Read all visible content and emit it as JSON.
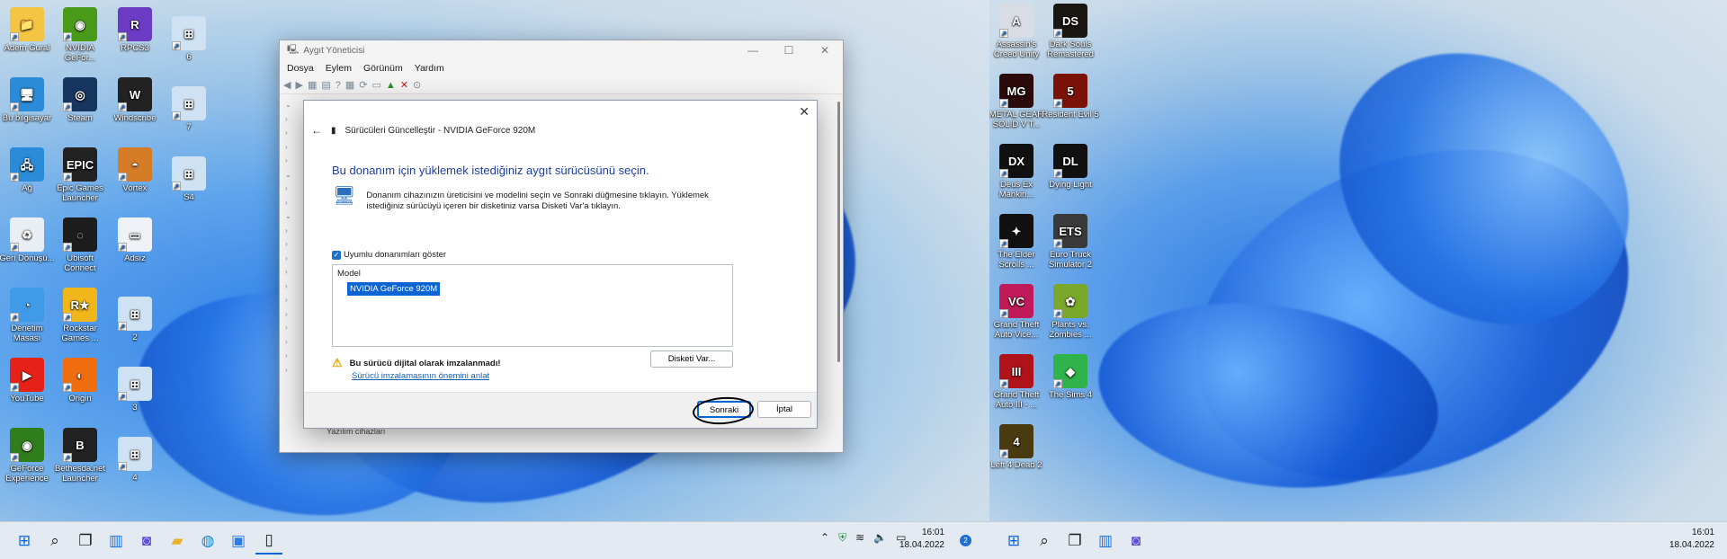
{
  "desktop_left": {
    "icons": [
      {
        "label": "Adem Gural",
        "icon": "folder-icon",
        "color": "#f4c542",
        "glyph": "📁"
      },
      {
        "label": "Bu bilgisayar",
        "icon": "monitor-icon",
        "color": "#2a8cd8",
        "glyph": "🖥"
      },
      {
        "label": "Ağ",
        "icon": "network-icon",
        "color": "#2a8cd8",
        "glyph": "🖧"
      },
      {
        "label": "Geri Dönüşü...",
        "icon": "recycle-bin-icon",
        "color": "#e8eef4",
        "glyph": "♻"
      },
      {
        "label": "Denetim Masası",
        "icon": "control-panel-icon",
        "color": "#3f9be8",
        "glyph": "◔"
      },
      {
        "label": "YouTube",
        "icon": "youtube-icon",
        "color": "#e62117",
        "glyph": "▶"
      },
      {
        "label": "GeForce Experience",
        "icon": "geforce-experience-icon",
        "color": "#2f7d1c",
        "glyph": "◉"
      },
      {
        "label": "NVIDIA GeFor...",
        "icon": "nvidia-icon",
        "color": "#4a9a1a",
        "glyph": "◉"
      },
      {
        "label": "Steam",
        "icon": "steam-icon",
        "color": "#17365f",
        "glyph": "◎"
      },
      {
        "label": "Epic Games Launcher",
        "icon": "epic-games-icon",
        "color": "#222",
        "glyph": "EPIC"
      },
      {
        "label": "Ubisoft Connect",
        "icon": "ubisoft-icon",
        "color": "#1d1d1d",
        "glyph": "◌"
      },
      {
        "label": "Rockstar Games ...",
        "icon": "rockstar-icon",
        "color": "#f1b61a",
        "glyph": "R★"
      },
      {
        "label": "Origin",
        "icon": "origin-icon",
        "color": "#f06d0f",
        "glyph": "◐"
      },
      {
        "label": "Bethesda.net Launcher",
        "icon": "bethesda-icon",
        "color": "#222",
        "glyph": "B"
      },
      {
        "label": "RPCS3",
        "icon": "rpcs3-icon",
        "color": "#6c3bc3",
        "glyph": "R"
      },
      {
        "label": "Windscribe",
        "icon": "windscribe-icon",
        "color": "#222",
        "glyph": "W"
      },
      {
        "label": "Vortex",
        "icon": "vortex-icon",
        "color": "#d47c26",
        "glyph": "◓"
      },
      {
        "label": "Adsız",
        "icon": "document-icon",
        "color": "#eef2f6",
        "glyph": "▭"
      },
      {
        "label": "2",
        "icon": "network-shortcut-icon",
        "color": "#cfe2f3",
        "glyph": "⊞"
      },
      {
        "label": "3",
        "icon": "network-shortcut-icon",
        "color": "#cfe2f3",
        "glyph": "⊞"
      },
      {
        "label": "4",
        "icon": "network-shortcut-icon",
        "color": "#cfe2f3",
        "glyph": "⊞"
      },
      {
        "label": "6",
        "icon": "network-shortcut-icon",
        "color": "#cfe2f3",
        "glyph": "⊞"
      },
      {
        "label": "7",
        "icon": "network-shortcut-icon",
        "color": "#cfe2f3",
        "glyph": "⊞"
      },
      {
        "label": "S4",
        "icon": "network-shortcut-icon",
        "color": "#cfe2f3",
        "glyph": "⊞"
      }
    ]
  },
  "desktop_right": {
    "icons": [
      {
        "label": "Assassin's Creed Unity",
        "icon": "assassins-creed-icon",
        "color": "#d8dde3",
        "glyph": "A"
      },
      {
        "label": "METAL GEAR SOLID V T...",
        "icon": "metal-gear-icon",
        "color": "#2a0a0a",
        "glyph": "MG"
      },
      {
        "label": "Deus Ex Mankin...",
        "icon": "deus-ex-icon",
        "color": "#111",
        "glyph": "DX"
      },
      {
        "label": "The Elder Scrolls ...",
        "icon": "elder-scrolls-icon",
        "color": "#111",
        "glyph": "✦"
      },
      {
        "label": "Grand Theft Auto Vice...",
        "icon": "gta-vice-city-icon",
        "color": "#c01a5a",
        "glyph": "VC"
      },
      {
        "label": "Grand Theft Auto III - ...",
        "icon": "gta-3-icon",
        "color": "#b0121a",
        "glyph": "III"
      },
      {
        "label": "Left 4 Dead 2",
        "icon": "left4dead-icon",
        "color": "#4a3a10",
        "glyph": "4"
      },
      {
        "label": "Dark Souls Remastered",
        "icon": "dark-souls-icon",
        "color": "#1a1612",
        "glyph": "DS"
      },
      {
        "label": "Resident Evil 5",
        "icon": "resident-evil-icon",
        "color": "#7a1208",
        "glyph": "5"
      },
      {
        "label": "Dying Light",
        "icon": "dying-light-icon",
        "color": "#111",
        "glyph": "DL"
      },
      {
        "label": "Euro Truck Simulator 2",
        "icon": "euro-truck-icon",
        "color": "#3a3a3a",
        "glyph": "ETS"
      },
      {
        "label": "Plants vs. Zombies ...",
        "icon": "plants-zombies-icon",
        "color": "#7aa82a",
        "glyph": "✿"
      },
      {
        "label": "The Sims 4",
        "icon": "sims-icon",
        "color": "#2fb34a",
        "glyph": "◆"
      }
    ]
  },
  "device_manager": {
    "title": "Aygıt Yöneticisi",
    "menu": [
      "Dosya",
      "Eylem",
      "Görünüm",
      "Yardım"
    ],
    "bottom_item": "Yazılım cihazları"
  },
  "dialog": {
    "header": "Sürücüleri Güncelleştir - NVIDIA GeForce 920M",
    "heading": "Bu donanım için yüklemek istediğiniz aygıt sürücüsünü seçin.",
    "info": "Donanım cihazınızın üreticisini ve modelini seçin ve Sonraki düğmesine tıklayın. Yüklemek istediğiniz sürücüyü içeren bir disketiniz varsa Disketi Var'a tıklayın.",
    "checkbox_label": "Uyumlu donanımları göster",
    "list_header": "Model",
    "selected_model": "NVIDIA GeForce 920M",
    "warning": "Bu sürücü dijital olarak imzalanmadı!",
    "link": "Sürücü imzalamasının önemini anlat",
    "have_disk": "Disketi Var...",
    "next": "Sonraki",
    "cancel": "İptal"
  },
  "taskbar_left": {
    "time": "16:01",
    "date": "18.04.2022",
    "notification_count": "2"
  },
  "taskbar_right": {
    "time": "16:01",
    "date": "18.04.2022"
  }
}
